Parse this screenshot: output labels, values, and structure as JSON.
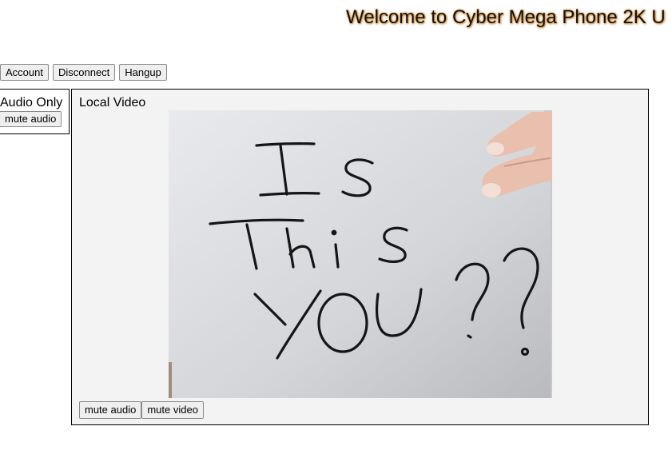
{
  "header": {
    "title": "Welcome to Cyber Mega Phone 2K U"
  },
  "toolbar": {
    "account_label": "Account",
    "disconnect_label": "Disconnect",
    "hangup_label": "Hangup"
  },
  "audio_panel": {
    "label": "Audio Only",
    "mute_audio_label": "mute audio"
  },
  "video_panel": {
    "label": "Local Video",
    "frame_text": "Is This YOU ??",
    "mute_audio_label": "mute audio",
    "mute_video_label": "mute video"
  },
  "colors": {
    "title_glow": "#c47a1c",
    "panel_background": "#f3f3f3",
    "paper": "#e6e7ea"
  }
}
